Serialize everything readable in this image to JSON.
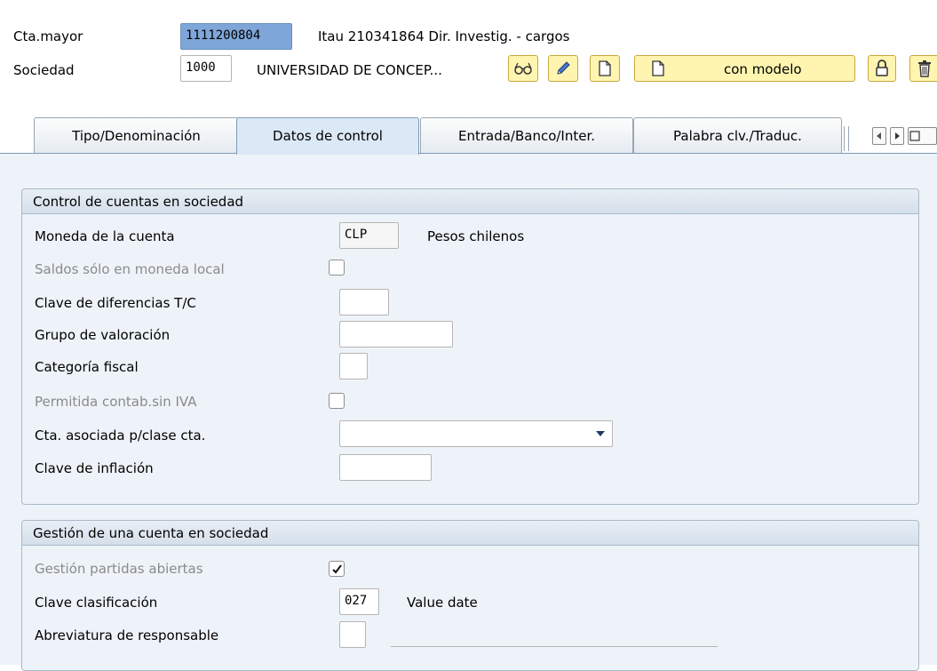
{
  "header": {
    "cta_mayor_label": "Cta.mayor",
    "cta_mayor_value": "1111200804",
    "cta_mayor_desc": "Itau 210341864 Dir. Investig. - cargos",
    "sociedad_label": "Sociedad",
    "sociedad_value": "1000",
    "sociedad_desc": "UNIVERSIDAD DE CONCEP...",
    "toolbar": {
      "display_icon": "glasses-icon",
      "edit_icon": "pencil-icon",
      "create_icon": "blank-document-icon",
      "with_template_icon": "blank-document-icon",
      "with_template_label": "con modelo",
      "lock_icon": "lock-icon",
      "delete_icon": "trash-icon"
    }
  },
  "tabs": [
    {
      "label": "Tipo/Denominación"
    },
    {
      "label": "Datos de control",
      "active": true
    },
    {
      "label": "Entrada/Banco/Inter."
    },
    {
      "label": "Palabra clv./Traduc."
    }
  ],
  "tab_nav": {
    "prev_icon": "triangle-left-icon",
    "next_icon": "triangle-right-icon",
    "list_icon": "tab-list-icon"
  },
  "control_group": {
    "title": "Control de cuentas en sociedad",
    "moneda_label": "Moneda de la cuenta",
    "moneda_value": "CLP",
    "moneda_desc": "Pesos chilenos",
    "saldos_label": "Saldos sólo en moneda local",
    "saldos_checked": false,
    "clave_dif_label": "Clave de diferencias T/C",
    "clave_dif_value": "",
    "grupo_val_label": "Grupo de valoración",
    "grupo_val_value": "",
    "cat_fiscal_label": "Categoría fiscal",
    "cat_fiscal_value": "",
    "permitida_label": "Permitida contab.sin IVA",
    "permitida_checked": false,
    "cta_asociada_label": "Cta. asociada p/clase cta.",
    "cta_asociada_value": "",
    "clave_infl_label": "Clave de inflación",
    "clave_infl_value": ""
  },
  "gestion_group": {
    "title": "Gestión de una cuenta en sociedad",
    "partidas_label": "Gestión partidas abiertas",
    "partidas_checked": true,
    "clave_clas_label": "Clave clasificación",
    "clave_clas_value": "027",
    "clave_clas_desc": "Value date",
    "abrev_label": "Abreviatura de responsable",
    "abrev_value": ""
  },
  "colors": {
    "selected_field": "#7fa6d8",
    "toolbar_button": "#fff5b0",
    "content_bg": "#eef3f9",
    "disabled_text": "#8a8a8a"
  }
}
